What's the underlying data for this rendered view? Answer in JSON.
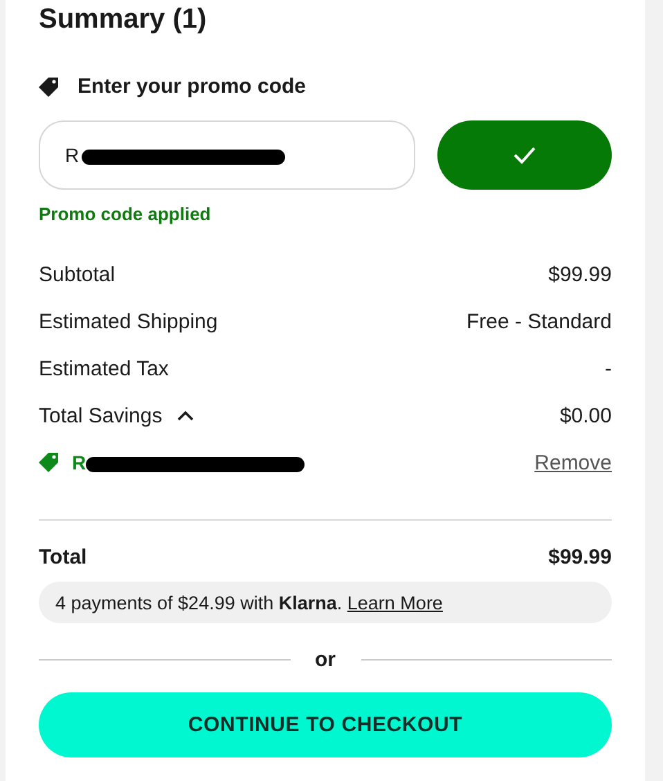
{
  "title": "Summary (1)",
  "promo": {
    "heading": "Enter your promo code",
    "value": "R",
    "applied": true,
    "status": "Promo code applied"
  },
  "rows": [
    {
      "kind": "plain",
      "label": "Subtotal",
      "value": "$99.99"
    },
    {
      "kind": "plain",
      "label": "Estimated Shipping",
      "value": "Free - Standard"
    },
    {
      "kind": "plain",
      "label": "Estimated Tax",
      "value": "-"
    },
    {
      "kind": "expandable",
      "label": "Total Savings",
      "value": "$0.00",
      "expanded": true
    }
  ],
  "applied_code": {
    "code": "R",
    "action": "Remove"
  },
  "total": {
    "label": "Total",
    "value": "$99.99"
  },
  "klarna": {
    "text": "4 payments of $24.99 with **Klarna**.",
    "link": "Learn More"
  },
  "divider_text": "or",
  "checkout": "CONTINUE TO CHECKOUT"
}
